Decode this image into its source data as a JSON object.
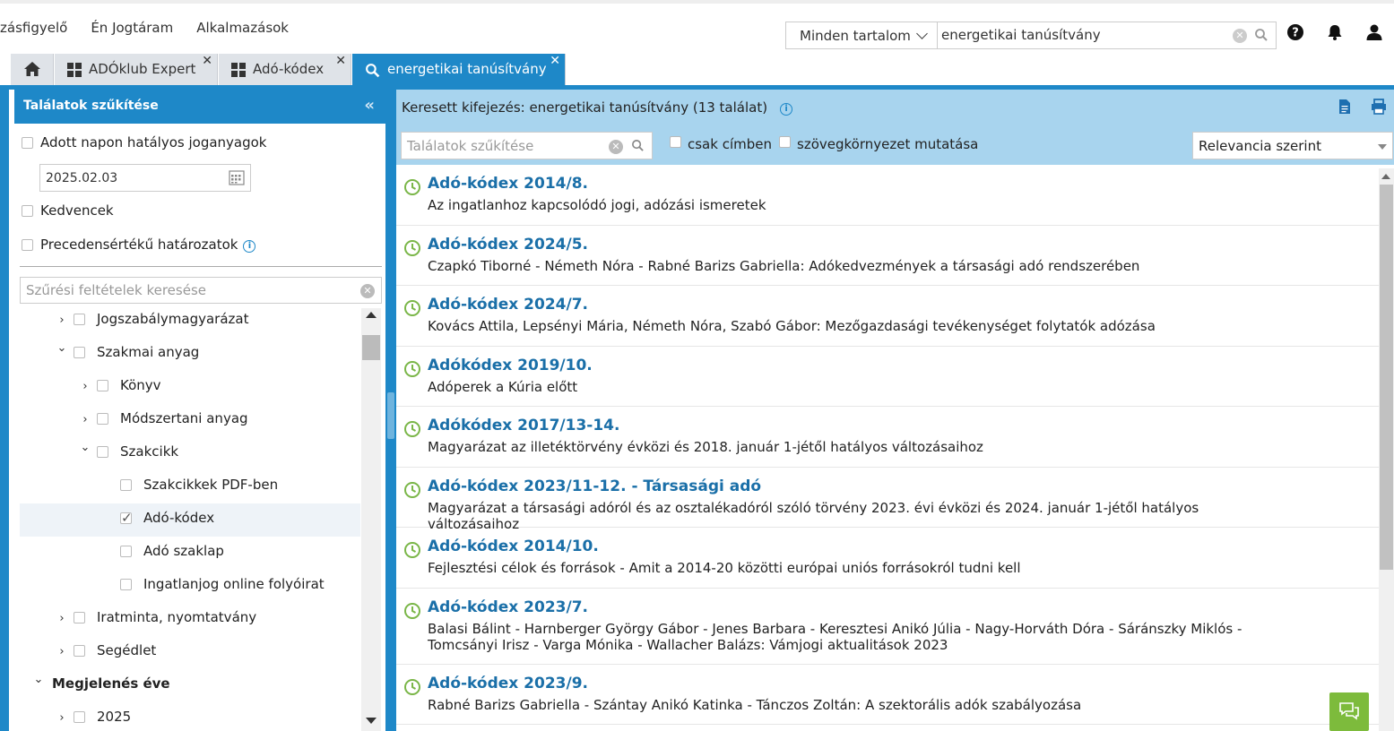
{
  "topnav": {
    "items": [
      "zásfigyelő",
      "Én Jogtáram",
      "Alkalmazások"
    ]
  },
  "search": {
    "scope": "Minden tartalom",
    "query": "energetikai tanúsítvány"
  },
  "tabs": [
    {
      "label": ""
    },
    {
      "label": "ADÓklub Expert"
    },
    {
      "label": "Adó-kódex"
    },
    {
      "label": "energetikai tanúsítvány"
    }
  ],
  "left": {
    "header": "Találatok szűkítése",
    "effective_label": "Adott napon hatályos joganyagok",
    "date": "2025.02.03",
    "favorites": "Kedvencek",
    "precedent": "Precedensértékű határozatok",
    "filter_placeholder": "Szűrési feltételek keresése",
    "tree": [
      {
        "label": "Jogszabálymagyarázat",
        "level": 1,
        "arrow": "›",
        "checked": false,
        "bold": false,
        "selected": false,
        "checkbox": true
      },
      {
        "label": "Szakmai anyag",
        "level": 1,
        "arrow": "⌄",
        "checked": false,
        "bold": false,
        "selected": false,
        "checkbox": true
      },
      {
        "label": "Könyv",
        "level": 2,
        "arrow": "›",
        "checked": false,
        "bold": false,
        "selected": false,
        "checkbox": true
      },
      {
        "label": "Módszertani anyag",
        "level": 2,
        "arrow": "›",
        "checked": false,
        "bold": false,
        "selected": false,
        "checkbox": true
      },
      {
        "label": "Szakcikk",
        "level": 2,
        "arrow": "⌄",
        "checked": false,
        "bold": false,
        "selected": false,
        "checkbox": true
      },
      {
        "label": "Szakcikkek PDF-ben",
        "level": 3,
        "arrow": "",
        "checked": false,
        "bold": false,
        "selected": false,
        "checkbox": true
      },
      {
        "label": "Adó-kódex",
        "level": 3,
        "arrow": "",
        "checked": true,
        "bold": false,
        "selected": true,
        "checkbox": true
      },
      {
        "label": "Adó szaklap",
        "level": 3,
        "arrow": "",
        "checked": false,
        "bold": false,
        "selected": false,
        "checkbox": true
      },
      {
        "label": "Ingatlanjog online folyóirat",
        "level": 3,
        "arrow": "",
        "checked": false,
        "bold": false,
        "selected": false,
        "checkbox": true
      },
      {
        "label": "Iratminta, nyomtatvány",
        "level": 1,
        "arrow": "›",
        "checked": false,
        "bold": false,
        "selected": false,
        "checkbox": true
      },
      {
        "label": "Segédlet",
        "level": 1,
        "arrow": "›",
        "checked": false,
        "bold": false,
        "selected": false,
        "checkbox": true
      },
      {
        "label": "Megjelenés éve",
        "level": 0,
        "arrow": "⌄",
        "checked": false,
        "bold": true,
        "selected": false,
        "checkbox": false
      },
      {
        "label": "2025",
        "level": 1,
        "arrow": "›",
        "checked": false,
        "bold": false,
        "selected": false,
        "checkbox": true
      }
    ]
  },
  "right": {
    "title": "Keresett kifejezés: energetikai tanúsítvány (13 találat)",
    "narrow_placeholder": "Találatok szűkítése",
    "only_titles": "csak címben",
    "show_context": "szövegkörnyezet mutatása",
    "sort": "Relevancia szerint",
    "results": [
      {
        "title": "Adó-kódex 2014/8.",
        "subtitle": "Az ingatlanhoz kapcsolódó jogi, adózási ismeretek"
      },
      {
        "title": "Adó-kódex 2024/5.",
        "subtitle": "Czapkó Tiborné - Németh Nóra - Rabné Barizs Gabriella: Adókedvezmények a társasági adó rendszerében"
      },
      {
        "title": "Adó-kódex 2024/7.",
        "subtitle": "Kovács Attila, Lepsényi Mária, Németh Nóra, Szabó Gábor: Mezőgazdasági tevékenységet folytatók adózása"
      },
      {
        "title": "Adókódex 2019/10.",
        "subtitle": "Adóperek a Kúria előtt"
      },
      {
        "title": "Adókódex 2017/13-14.",
        "subtitle": "Magyarázat az illetéktörvény évközi és 2018. január 1-jétől hatályos változásaihoz"
      },
      {
        "title": "Adó-kódex 2023/11-12. - Társasági adó",
        "subtitle": "Magyarázat a társasági adóról és az osztalékadóról szóló törvény 2023. évi évközi és 2024. január 1-jétől hatályos változásaihoz"
      },
      {
        "title": "Adó-kódex 2014/10.",
        "subtitle": "Fejlesztési célok és források - Amit a 2014-20 közötti európai uniós forrásokról tudni kell"
      },
      {
        "title": "Adó-kódex 2023/7.",
        "subtitle": "Balasi Bálint - Harnberger György Gábor - Jenes Barbara - Keresztesi Anikó Júlia - Nagy-Horváth Dóra - Sáránszky Miklós - Tomcsányi Irisz - Varga Mónika - Wallacher Balázs: Vámjogi aktualitások 2023"
      },
      {
        "title": "Adó-kódex 2023/9.",
        "subtitle": "Rabné Barizs Gabriella - Szántay Anikó Katinka - Tánczos Zoltán: A szektorális adók szabályozása"
      }
    ]
  }
}
